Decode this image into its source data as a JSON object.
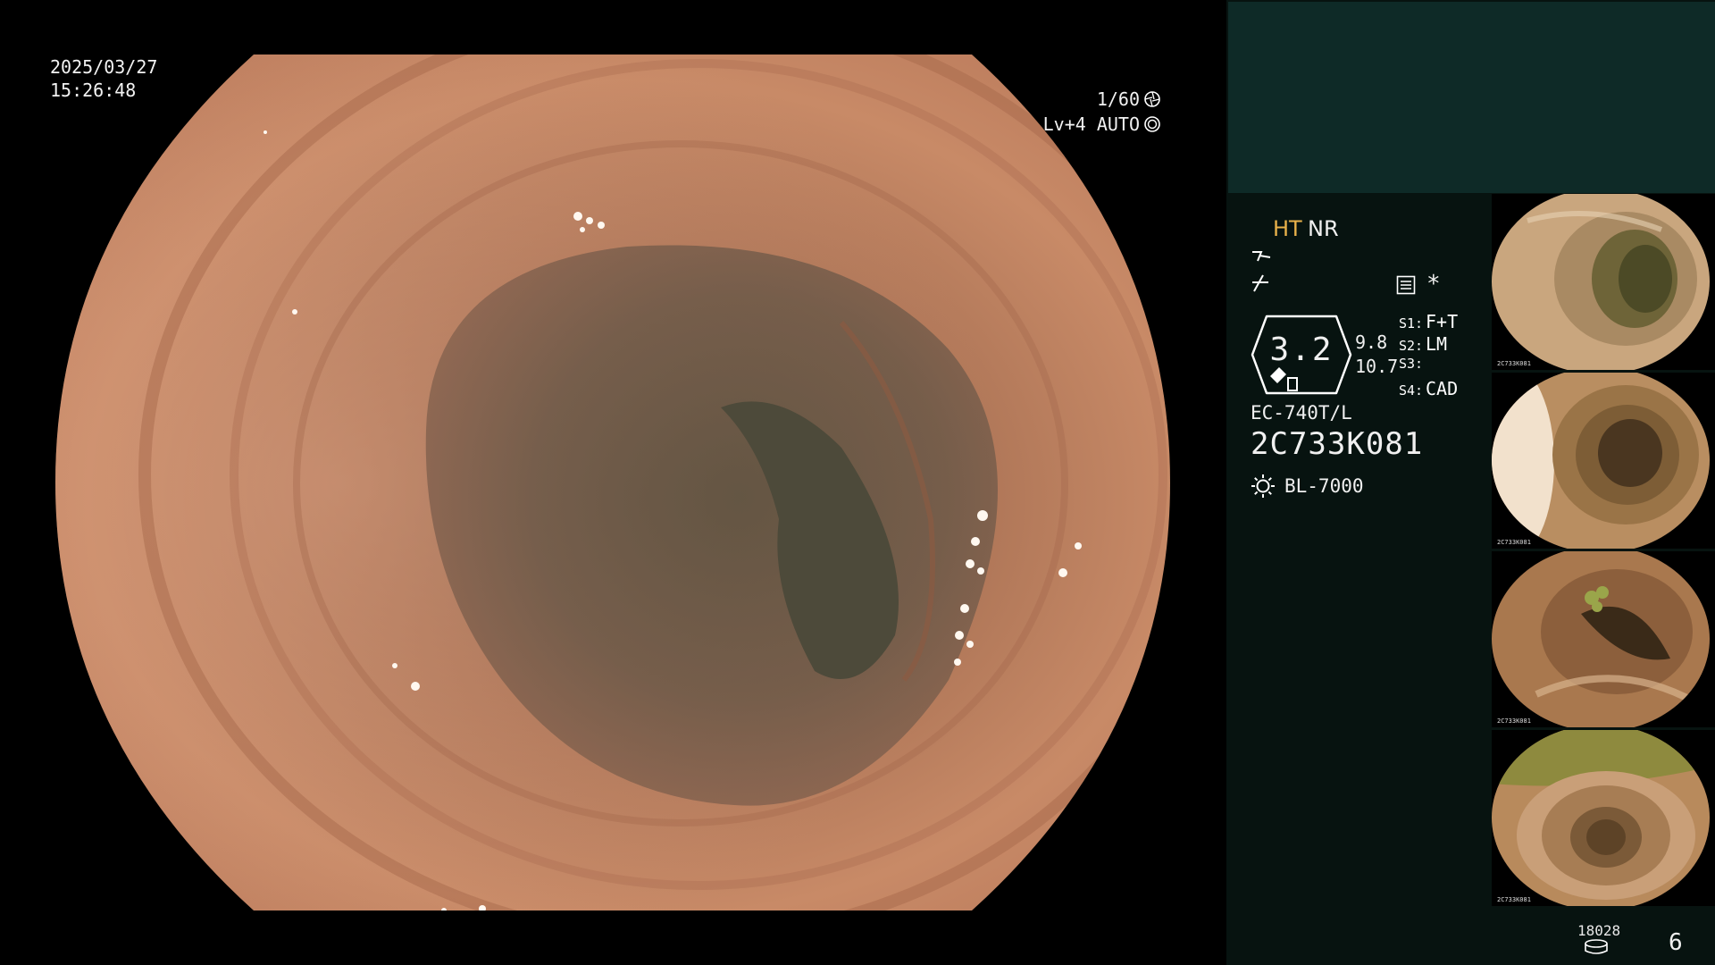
{
  "osd": {
    "date": "2025/03/27",
    "time": "15:26:48",
    "shutter": "1/60",
    "level": "Lv+4 AUTO"
  },
  "panel": {
    "mode_ht": "HT",
    "mode_nr": "NR",
    "star": "*",
    "zoom_value": "3.2",
    "zoom_a": "9.8",
    "zoom_b": "10.7",
    "s1_key": "S1:",
    "s1_val": "F+T",
    "s2_key": "S2:",
    "s2_val": "LM",
    "s3_key": "S3:",
    "s3_val": "",
    "s4_key": "S4:",
    "s4_val": "CAD",
    "scope_model": "EC-740T/L",
    "serial": "2C733K081",
    "light_source": "BL-7000"
  },
  "thumbnails": [
    {
      "id": "thumb-1",
      "code": "2C733K081"
    },
    {
      "id": "thumb-2",
      "code": "2C733K081"
    },
    {
      "id": "thumb-3",
      "code": "2C733K081"
    },
    {
      "id": "thumb-4",
      "code": "2C733K081"
    }
  ],
  "footer": {
    "record_count": "18028",
    "page_number": "6"
  },
  "colors": {
    "panel_bg": "#071310",
    "panel_top": "#0e2a27",
    "ht_accent": "#e8b14a",
    "mucosa": "#c98a66"
  },
  "icons": [
    "aperture-icon",
    "iris-icon",
    "enhancement-icon",
    "color-eq-icon",
    "menu-grid-icon",
    "light-source-icon",
    "storage-icon"
  ]
}
